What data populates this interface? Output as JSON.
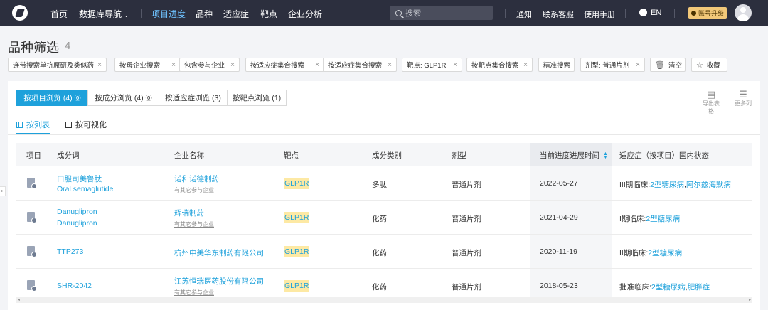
{
  "nav": {
    "home": "首页",
    "database_nav": "数据库导航",
    "project_progress": "项目进度",
    "variety": "品种",
    "indication": "适应症",
    "target": "靶点",
    "company_analysis": "企业分析",
    "search_placeholder": "搜索",
    "notify": "通知",
    "support": "联系客服",
    "manual": "使用手册",
    "lang": "EN",
    "upgrade": "账号升级"
  },
  "page": {
    "title": "品种筛选",
    "count": "4"
  },
  "filters": [
    {
      "label": "连带搜索单抗原研及类似药"
    },
    {
      "label": "按母企业搜索"
    },
    {
      "label": "包含参与企业"
    },
    {
      "label": "按适应症集合搜索"
    },
    {
      "label": "按适应症集合搜索"
    },
    {
      "label": "靶点: GLP1R"
    },
    {
      "label": "按靶点集合搜索"
    },
    {
      "label": "精准搜索"
    },
    {
      "label": "剂型: 普通片剂"
    }
  ],
  "actions": {
    "clear": "清空",
    "favorite": "收藏"
  },
  "tabs": [
    {
      "label": "按项目浏览 (4)"
    },
    {
      "label": "按成分浏览 (4)"
    },
    {
      "label": "按适应症浏览 (3)"
    },
    {
      "label": "按靶点浏览 (1)"
    }
  ],
  "tools": {
    "export": "导出表格",
    "more": "更多列"
  },
  "subtabs": {
    "list": "按列表",
    "visual": "按可视化"
  },
  "table": {
    "headers": {
      "project": "项目",
      "ingredient": "成分词",
      "company": "企业名称",
      "target": "靶点",
      "category": "成分类别",
      "form": "剂型",
      "date": "当前进度进展时间",
      "indication": "适应症（按项目）国内状态"
    },
    "rows": [
      {
        "name_cn": "口服司美鲁肽",
        "name_en": "Oral semaglutide",
        "company": "诺和诺德制药",
        "company_note": "有其它参与企业",
        "target": "GLP1R",
        "category": "多肽",
        "form": "普通片剂",
        "date": "2022-05-27",
        "status": "III期临床:",
        "ind1": "2型糖尿病",
        "sep": ",",
        "ind2": "阿尔兹海默病"
      },
      {
        "name_cn": "Danuglipron",
        "name_en": "Danuglipron",
        "company": "辉瑞制药",
        "company_note": "有其它参与企业",
        "target": "GLP1R",
        "category": "化药",
        "form": "普通片剂",
        "date": "2021-04-29",
        "status": "I期临床:",
        "ind1": "2型糖尿病"
      },
      {
        "name_cn": "TTP273",
        "company": "杭州中美华东制药有限公司",
        "target": "GLP1R",
        "category": "化药",
        "form": "普通片剂",
        "date": "2020-11-19",
        "status": "II期临床:",
        "ind1": "2型糖尿病"
      },
      {
        "name_cn": "SHR-2042",
        "company": "江苏恒瑞医药股份有限公司",
        "company_note": "有其它参与企业",
        "target": "GLP1R",
        "category": "化药",
        "form": "普通片剂",
        "date": "2018-05-23",
        "status": "批准临床:",
        "ind1": "2型糖尿病",
        "sep": ",",
        "ind2": "肥胖症"
      }
    ]
  }
}
